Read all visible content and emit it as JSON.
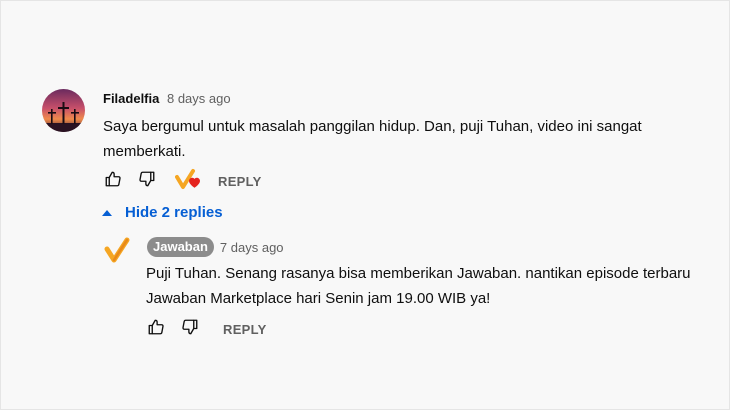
{
  "comment": {
    "author": "Filadelfia",
    "time": "8 days ago",
    "text": "Saya bergumul untuk masalah panggilan hidup. Dan, puji Tuhan, video ini sangat memberkati.",
    "reply_label": "REPLY"
  },
  "replies_toggle": {
    "label": "Hide 2 replies"
  },
  "reply": {
    "author": "Jawaban",
    "time": "7 days ago",
    "text": "Puji Tuhan. Senang rasanya bisa memberikan Jawaban. nantikan episode terbaru Jawaban Marketplace hari Senin jam 19.00 WIB ya!",
    "reply_label": "REPLY"
  },
  "colors": {
    "link_blue": "#065fd4",
    "heart_red": "#e5241f",
    "brand_orange": "#f5a623",
    "badge_gray": "#8c8c8c"
  }
}
